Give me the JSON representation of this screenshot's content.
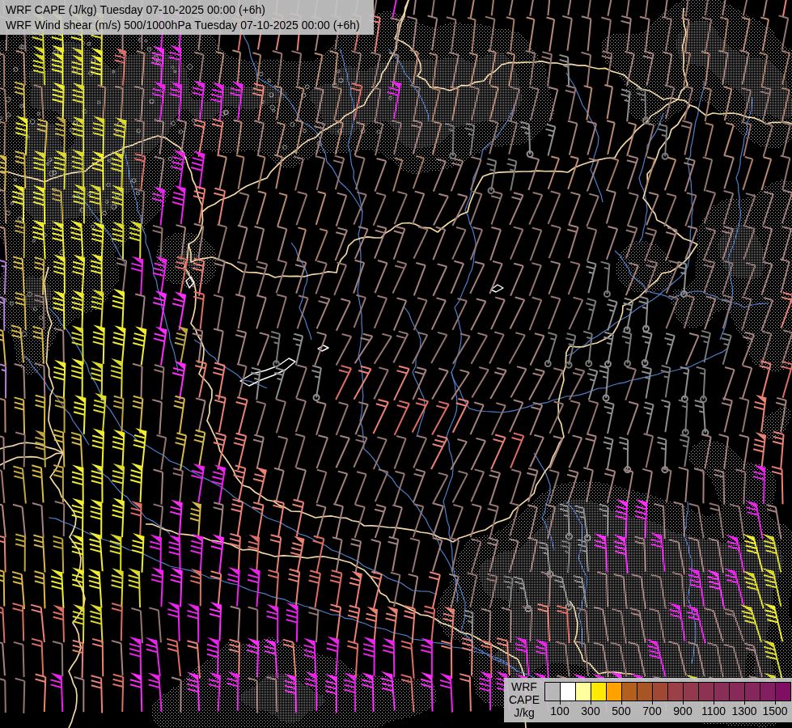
{
  "titles": {
    "line1": "WRF CAPE (J/kg) Tuesday 07-10-2025 00:00 (+6h)",
    "line2": "WRF Wind shear (m/s) 500/1000hPa Tuesday 07-10-2025 00:00 (+6h)"
  },
  "legend": {
    "label_lines": [
      "WRF",
      "CAPE",
      "J/kg"
    ],
    "tick_labels": [
      "100",
      "300",
      "500",
      "700",
      "900",
      "1100",
      "1300",
      "1500"
    ],
    "swatch_colors": [
      "transparent",
      "#ffffff",
      "#ffff9e",
      "#ffe900",
      "#ffa200",
      "#b45f1e",
      "#a85526",
      "#a04834",
      "#9a4046",
      "#92394e",
      "#8d3253",
      "#892e57",
      "#872a5a",
      "#85265d",
      "#831e60",
      "#800f63"
    ],
    "box_color": "#c5c5c5"
  },
  "map": {
    "background": "#000000",
    "border_color": "#f2d7a2",
    "river_color": "#4d7ec8",
    "terrain_dot_color": "#a0a0a0",
    "lake_outline_color": "#ffffff",
    "barb_palette": {
      "yellow": "#f2ee2d",
      "pale_yellow": "#f4f0a0",
      "gold": "#d9b944",
      "salmon": "#ec8273",
      "red": "#df6e62",
      "mauve": "#a5827f",
      "tan": "#bb8a70",
      "gray": "#8f8f8f",
      "magenta": "#ee22ee",
      "purple": "#b87fd6",
      "white": "#ffffff"
    }
  }
}
